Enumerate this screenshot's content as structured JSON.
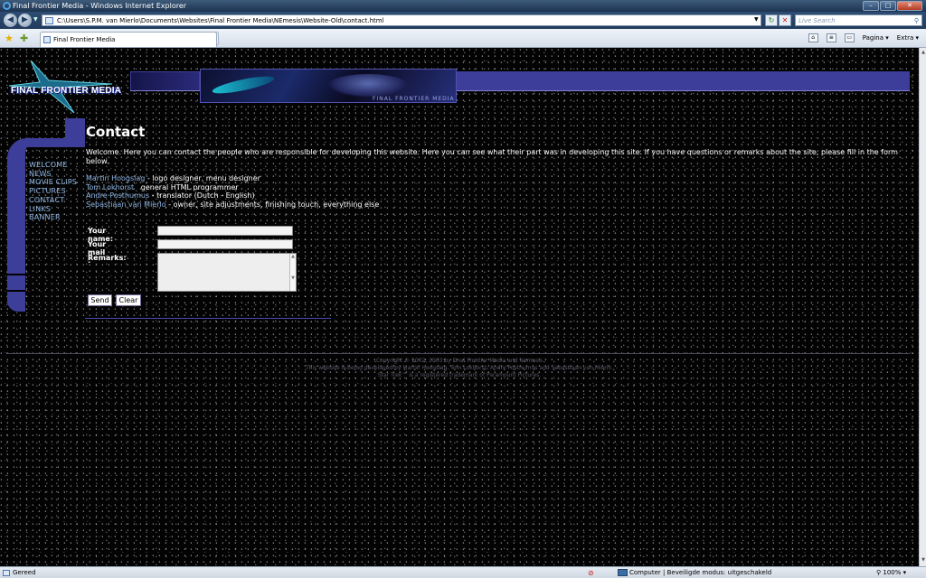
{
  "browser": {
    "window_title": "Final Frontier Media - Windows Internet Explorer",
    "address": "C:\\Users\\S.P.M. van Mierlo\\Documents\\Websites\\Final Frontier Media\\NEmesis\\Website-Old\\contact.html",
    "search_placeholder": "Live Search",
    "tab_title": "Final Frontier Media",
    "cmd_page": "Pagina",
    "cmd_extra": "Extra",
    "status_text": "Gereed",
    "status_zone": "Computer | Beveiligde modus: uitgeschakeld",
    "zoom": "100%"
  },
  "site": {
    "logo_text": "FINAL FRONTIER MEDIA",
    "banner_caption": "FINAL FRONTIER MEDIA",
    "nav": [
      "WELCOME",
      "NEWS",
      "MOVIE CLIPS",
      "PICTURES",
      "CONTACT",
      "LINKS",
      "BANNER"
    ]
  },
  "content": {
    "title": "Contact",
    "intro": "Welcome. Here you can contact the people who are responsible for developing this website. Here you can see what their part was in developing this site. If you have questions or remarks about the site, please fill in the form below.",
    "credits": [
      {
        "name": "Martin Hoogslag",
        "role": " - logo designer, menu designer"
      },
      {
        "name": "Tom Lokhorst",
        "role": "   general HTML programmer"
      },
      {
        "name": "Andre Posthumus",
        "role": " - translator (Dutch - English)"
      },
      {
        "name": "Sebastiaan van Mierlo",
        "role": " - owner, site adjustments, finishing touch, everything else"
      }
    ]
  },
  "form": {
    "name_label": "Your name:",
    "mail_label": "Your mail :",
    "remarks_label": "Remarks:",
    "name_value": "",
    "mail_value": "",
    "remarks_value": "",
    "send_label": "Send",
    "clear_label": "Clear"
  },
  "footer": {
    "line1": "Copyright © 2002, 2003 by Final Frontier Media and Nemesis",
    "line2": "This website is being developed by Martin Hoogslag, Tom Lokhorst, Andre Posthumus and Sebastiaan van Mierlo.",
    "line3": "Star Trek™ is a registered trademark of Paramount Pictures."
  },
  "colors": {
    "lcars_blue": "#3d3d9a",
    "link": "#8fb7e6",
    "background": "#030303"
  }
}
